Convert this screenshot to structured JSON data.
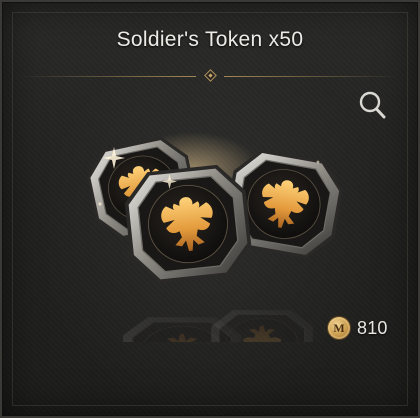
{
  "item": {
    "title": "Soldier's Token x50"
  },
  "price": {
    "currency_symbol": "M",
    "value": "810"
  },
  "icons": {
    "search": "magnifier-icon",
    "currency": "mileage-coin-icon"
  },
  "colors": {
    "accent_gold": "#c9a86a",
    "token_gold": "#e7a64a",
    "panel_bg": "#242422"
  }
}
